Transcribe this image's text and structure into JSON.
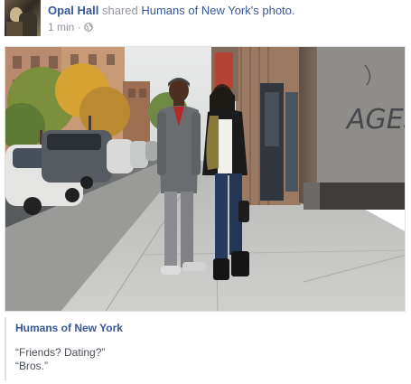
{
  "post": {
    "author": "Opal Hall",
    "action": "shared",
    "source_page": "Humans of New York",
    "source_suffix": "'s photo.",
    "time": "1 min",
    "time_separator": "·",
    "privacy_icon": "globe-icon"
  },
  "photo": {
    "graffiti": "AGES"
  },
  "caption": {
    "page_name": "Humans of New York",
    "line1": "“Friends? Dating?”",
    "line2": "“Bros.”"
  },
  "colors": {
    "link": "#365899",
    "muted": "#90949c",
    "text": "#4b4f56"
  }
}
